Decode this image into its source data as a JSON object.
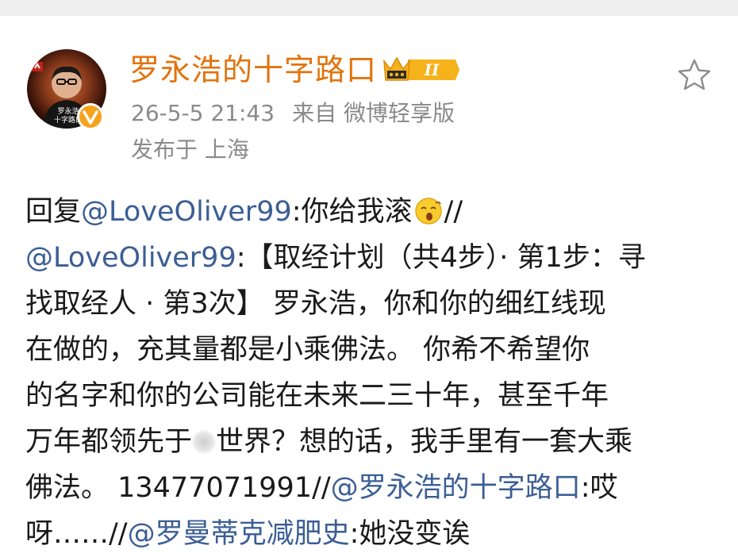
{
  "author": {
    "name": "罗永浩的十字路口",
    "vip_level": "II",
    "avatar_caption": "罗永浩 十字路口"
  },
  "meta": {
    "timestamp": "26-5-5 21:43",
    "source_prefix": "来自",
    "source_client": "微博轻享版",
    "location_prefix": "发布于",
    "location": "上海"
  },
  "post": {
    "line1": {
      "prefix": "回复",
      "mention": "@LoveOliver99",
      "text": ":你给我滚",
      "emoji": "yawn-emoji",
      "suffix": "//"
    },
    "line2": {
      "mention": "@LoveOliver99",
      "text": ":【取经计划（共4步）· 第1步：寻"
    },
    "line3": "找取经人 · 第3次】 罗永浩，你和你的细红线现",
    "line4": "在做的，充其量都是小乘佛法。 你希不希望你",
    "line5": "的名字和你的公司能在未来二三十年，甚至千年",
    "line6": {
      "before": "万年都领先于",
      "after": "世界？想的话，我手里有一套大乘"
    },
    "line7": {
      "text": "佛法。 13477071991//",
      "mention": "@罗永浩的十字路口",
      "suffix": ":哎"
    },
    "line8": {
      "text": "呀……//",
      "mention": "@罗曼蒂克减肥史",
      "suffix": ":她没变诶"
    }
  },
  "colors": {
    "author_name": "#e2730c",
    "mention": "#3b5e95",
    "meta_text": "#8a8a8a",
    "badge": "#f7a21b"
  }
}
